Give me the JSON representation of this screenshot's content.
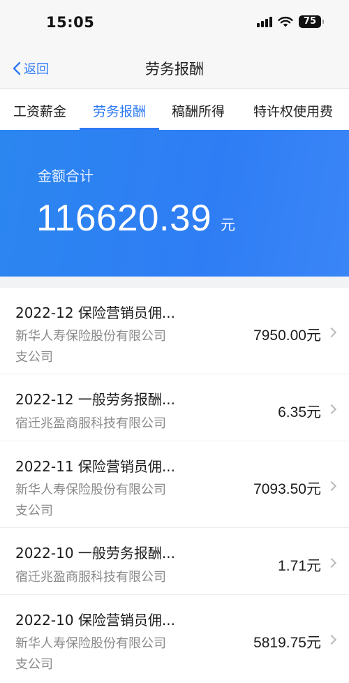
{
  "status_bar": {
    "time": "15:05",
    "battery": "75"
  },
  "nav": {
    "back_label": "返回",
    "title": "劳务报酬"
  },
  "tabs": [
    {
      "label": "工资薪金",
      "active": false
    },
    {
      "label": "劳务报酬",
      "active": true
    },
    {
      "label": "稿酬所得",
      "active": false
    },
    {
      "label": "特许权使用费",
      "active": false
    }
  ],
  "summary": {
    "label": "金额合计",
    "amount": "116620.39",
    "unit": "元"
  },
  "records": [
    {
      "title": "2022-12 保险营销员佣...",
      "payer_line1": "新华人寿保险股份有限公司",
      "payer_line2": "支公司",
      "amount": "7950.00元"
    },
    {
      "title": "2022-12 一般劳务报酬...",
      "payer_line1": "宿迁兆盈商服科技有限公司",
      "payer_line2": "",
      "amount": "6.35元"
    },
    {
      "title": "2022-11 保险营销员佣...",
      "payer_line1": "新华人寿保险股份有限公司",
      "payer_line2": "支公司",
      "amount": "7093.50元"
    },
    {
      "title": "2022-10 一般劳务报酬...",
      "payer_line1": "宿迁兆盈商服科技有限公司",
      "payer_line2": "",
      "amount": "1.71元"
    },
    {
      "title": "2022-10 保险营销员佣...",
      "payer_line1": "新华人寿保险股份有限公司",
      "payer_line2": "支公司",
      "amount": "5819.75元"
    }
  ]
}
